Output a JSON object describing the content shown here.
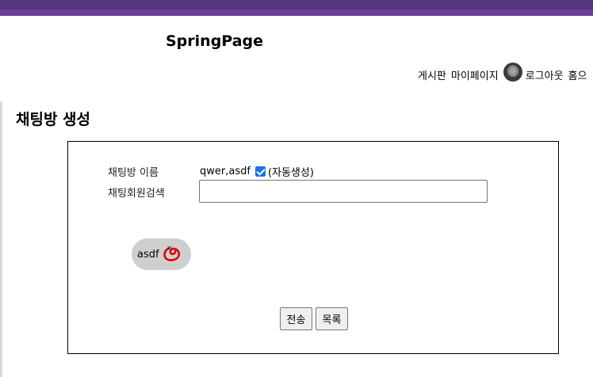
{
  "site": {
    "title": "SpringPage"
  },
  "nav": {
    "board": "게시판",
    "mypage": "마이페이지",
    "logout": "로그아웃",
    "home": "홈으"
  },
  "page": {
    "heading": "채팅방 생성"
  },
  "form": {
    "room_name_label": "채팅방 이름",
    "room_name_value": "qwer,asdf",
    "auto_generate_checked": true,
    "auto_generate_label": "(자동생성)",
    "member_search_label": "채팅회원검색",
    "member_search_value": "",
    "selected_members": [
      {
        "name": "asdf",
        "remove_symbol": "×"
      }
    ],
    "submit_label": "전송",
    "list_label": "목록"
  },
  "colors": {
    "topbar": "#56357f",
    "accent": "#6a3f9a",
    "chip_bg": "#cfcfcf",
    "highlight_circle": "#e00000",
    "checkbox": "#1a73e8"
  }
}
